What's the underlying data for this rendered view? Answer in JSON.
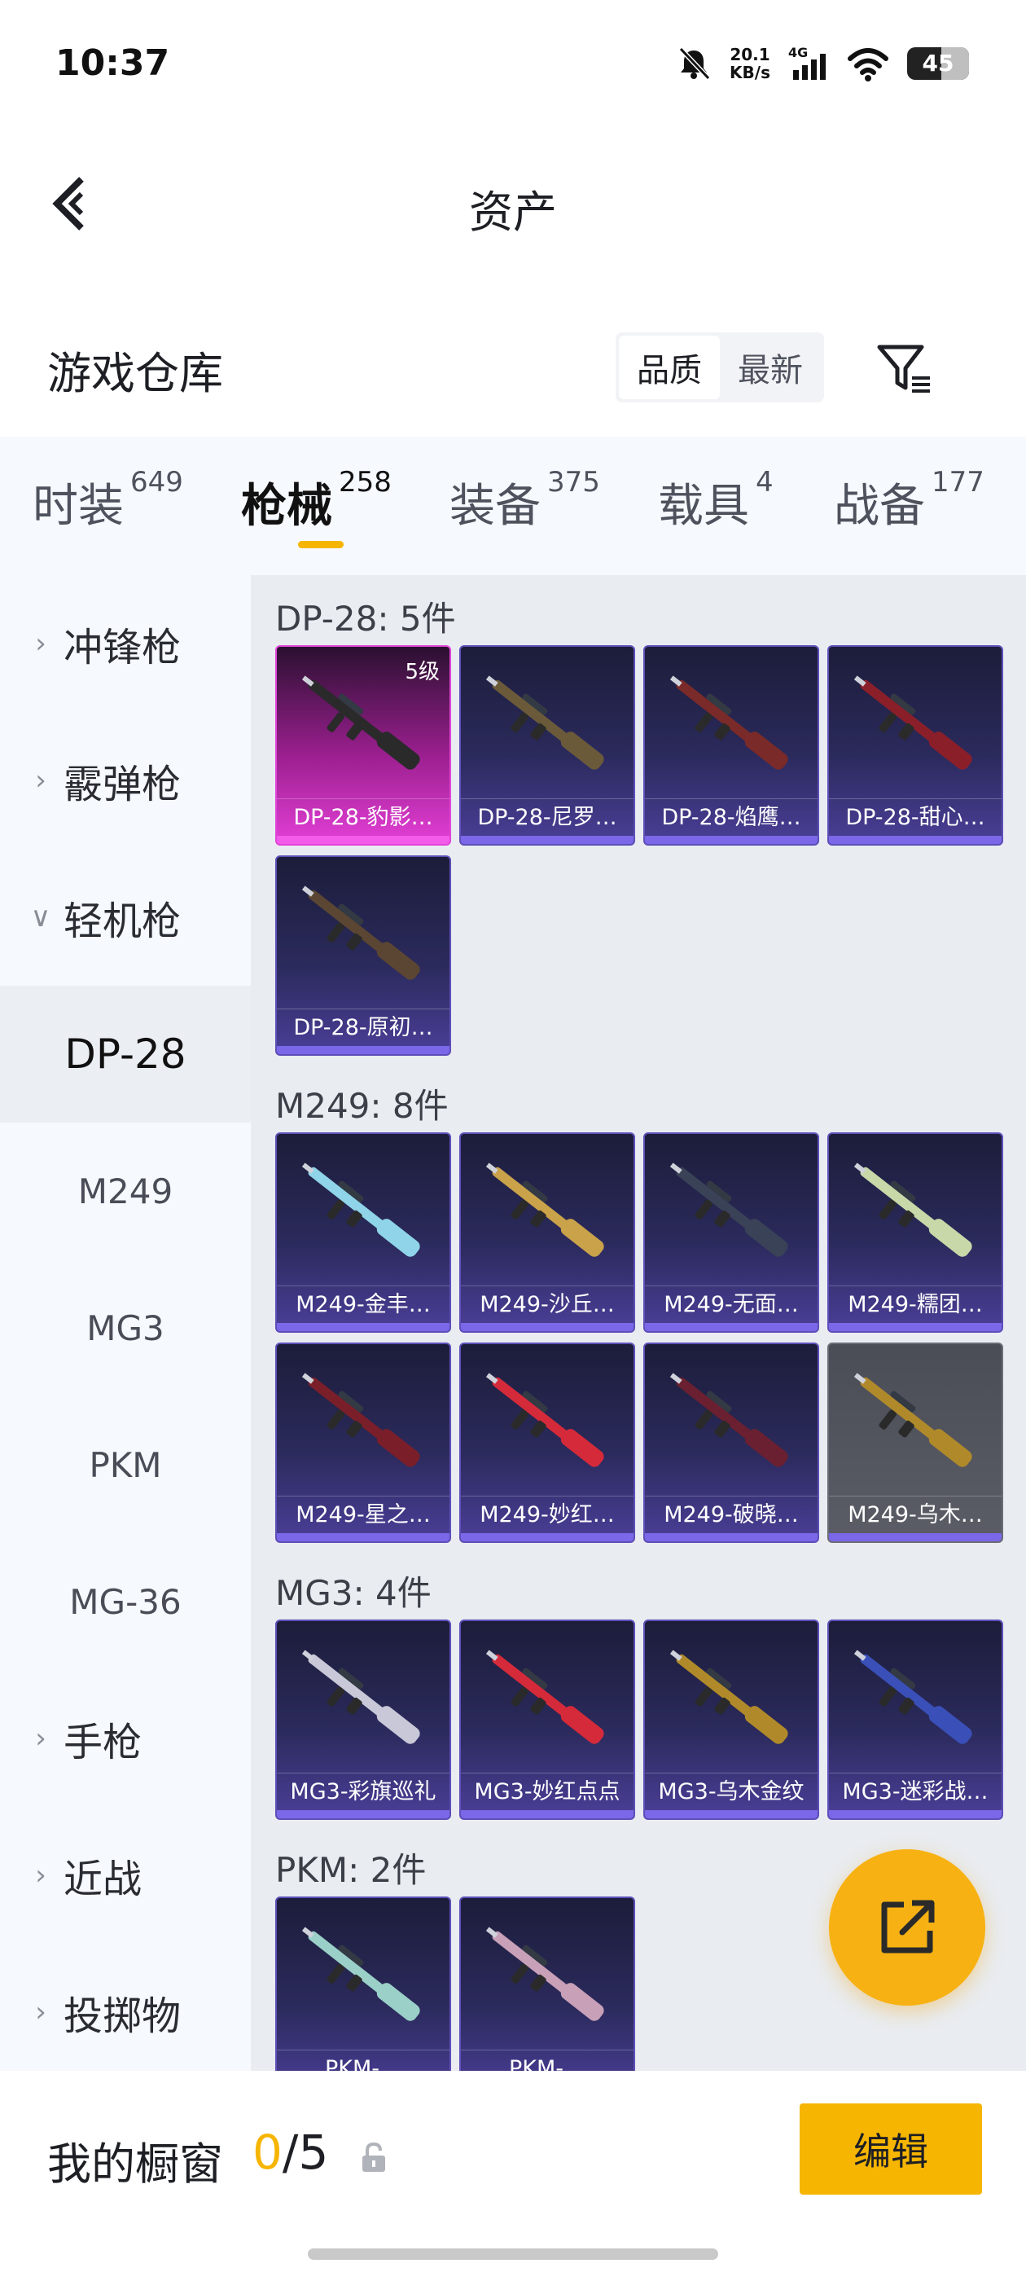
{
  "status": {
    "time": "10:37",
    "speed_value": "20.1",
    "speed_unit": "KB/s",
    "network": "4G",
    "battery": "45",
    "battery_level": 0.45
  },
  "header": {
    "title": "资产"
  },
  "warehouse": {
    "title": "游戏仓库",
    "sort_options": [
      "品质",
      "最新"
    ],
    "active_sort": 0
  },
  "tabs": [
    {
      "label": "时装",
      "count": "649"
    },
    {
      "label": "枪械",
      "count": "258"
    },
    {
      "label": "装备",
      "count": "375"
    },
    {
      "label": "载具",
      "count": "4"
    },
    {
      "label": "战备",
      "count": "177"
    }
  ],
  "active_tab": 1,
  "sidebar": [
    {
      "label": "冲锋枪",
      "type": "category",
      "expanded": false
    },
    {
      "label": "霰弹枪",
      "type": "category",
      "expanded": false
    },
    {
      "label": "轻机枪",
      "type": "category",
      "expanded": true
    },
    {
      "label": "DP-28",
      "type": "sub",
      "active": true
    },
    {
      "label": "M249",
      "type": "sub"
    },
    {
      "label": "MG3",
      "type": "sub"
    },
    {
      "label": "PKM",
      "type": "sub"
    },
    {
      "label": "MG-36",
      "type": "sub"
    },
    {
      "label": "手枪",
      "type": "category",
      "expanded": false
    },
    {
      "label": "近战",
      "type": "category",
      "expanded": false
    },
    {
      "label": "投掷物",
      "type": "category",
      "expanded": false
    }
  ],
  "groups": [
    {
      "title": "DP-28: 5件",
      "items": [
        {
          "label": "DP-28-豹影…",
          "level": "5级",
          "style": "pink",
          "accent": "#2a2a2a"
        },
        {
          "label": "DP-28-尼罗…",
          "accent": "#6b5a3a"
        },
        {
          "label": "DP-28-焰鹰…",
          "accent": "#7a2a28"
        },
        {
          "label": "DP-28-甜心…",
          "accent": "#8a1f2a"
        },
        {
          "label": "DP-28-原初…",
          "accent": "#5a4632"
        }
      ]
    },
    {
      "title": "M249: 8件",
      "items": [
        {
          "label": "M249-金丰…",
          "accent": "#8fd4e8"
        },
        {
          "label": "M249-沙丘…",
          "accent": "#c9a24a"
        },
        {
          "label": "M249-无面…",
          "accent": "#3a4258"
        },
        {
          "label": "M249-糯团…",
          "accent": "#c8d8a8"
        },
        {
          "label": "M249-星之…",
          "accent": "#7a1f2a"
        },
        {
          "label": "M249-妙红…",
          "accent": "#d42a3a"
        },
        {
          "label": "M249-破晓…",
          "accent": "#6a2030"
        },
        {
          "label": "M249-乌木…",
          "style": "grey",
          "accent": "#b08a2a"
        }
      ]
    },
    {
      "title": "MG3: 4件",
      "items": [
        {
          "label": "MG3-彩旗巡礼",
          "accent": "#c8c8d8"
        },
        {
          "label": "MG3-妙红点点",
          "accent": "#d42a3a"
        },
        {
          "label": "MG3-乌木金纹",
          "accent": "#b08a2a"
        },
        {
          "label": "MG3-迷彩战…",
          "accent": "#3a50b8"
        }
      ]
    },
    {
      "title": "PKM: 2件",
      "items": [
        {
          "label": "PKM-…",
          "accent": "#9ad0c8"
        },
        {
          "label": "PKM-…",
          "accent": "#c8a0b8"
        }
      ]
    }
  ],
  "showcase": {
    "label": "我的橱窗",
    "current": "0",
    "total": "/5"
  },
  "edit_button": "编辑",
  "colors": {
    "accent": "#f6b500",
    "card_bottom": "#7a68e8",
    "rare": "#e33fd6"
  }
}
